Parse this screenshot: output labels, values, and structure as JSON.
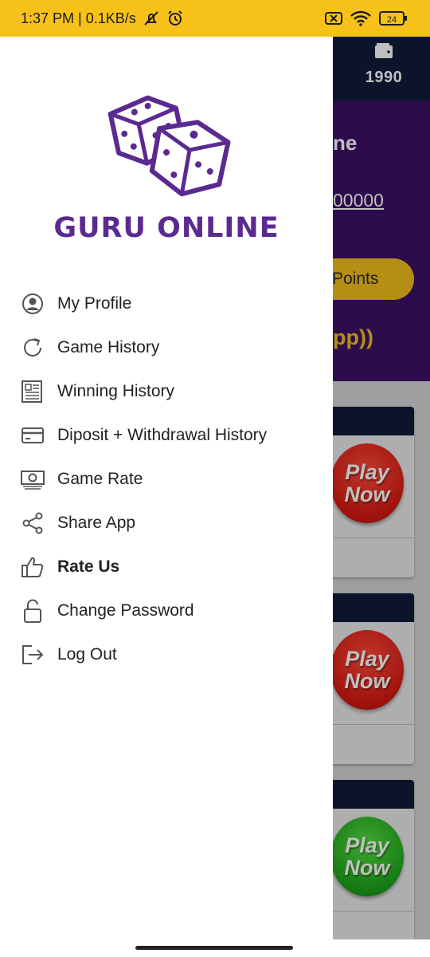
{
  "status_bar": {
    "time_speed": "1:37 PM | 0.1KB/s",
    "battery": "24",
    "icons": [
      "silent-icon",
      "alarm-icon",
      "sim-off-icon",
      "wifi-icon",
      "battery-icon"
    ]
  },
  "background_app": {
    "wallet_amount": "1990",
    "name_partial": "ne",
    "number_partial": "00000",
    "points_label": "Points",
    "app_text_partial": "pp))",
    "play_label_1": "Play",
    "play_label_2": "Now"
  },
  "drawer": {
    "brand": "GURU ONLINE",
    "menu": [
      {
        "label": "My Profile",
        "icon": "profile-icon"
      },
      {
        "label": "Game History",
        "icon": "refresh-icon"
      },
      {
        "label": "Winning History",
        "icon": "newspaper-icon"
      },
      {
        "label": "Diposit + Withdrawal History",
        "icon": "card-icon"
      },
      {
        "label": "Game Rate",
        "icon": "money-icon"
      },
      {
        "label": "Share App",
        "icon": "share-icon"
      },
      {
        "label": "Rate Us",
        "icon": "thumbs-up-icon"
      },
      {
        "label": "Change Password",
        "icon": "unlock-icon"
      },
      {
        "label": "Log Out",
        "icon": "logout-icon"
      }
    ]
  },
  "colors": {
    "status_bar": "#f6c21a",
    "brand_purple": "#5b2a91",
    "header_navy": "#0f1b3a",
    "purple_bg": "#3b1166",
    "gold": "#f1be1d",
    "play_red": "#d61a12",
    "play_green": "#1ea41a"
  }
}
